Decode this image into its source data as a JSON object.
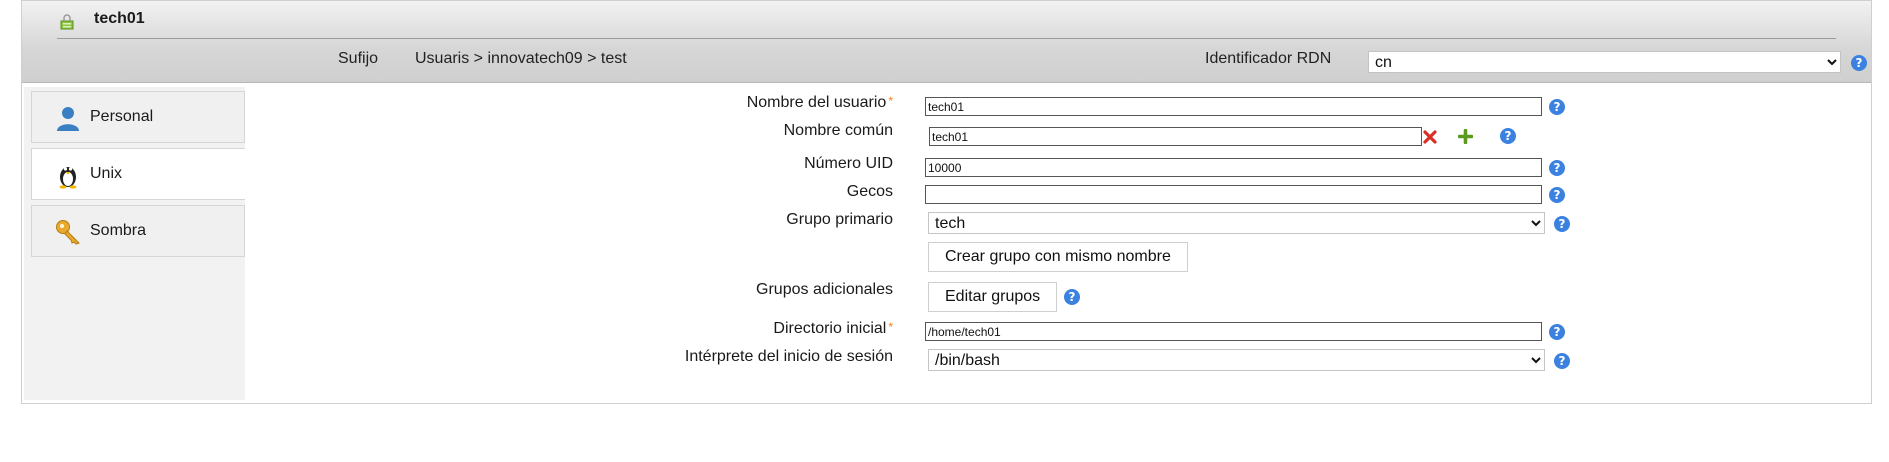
{
  "header": {
    "title": "tech01",
    "suffix_label": "Sufijo",
    "suffix_path": "Usuaris > innovatech09 > test",
    "rdn_label": "Identificador RDN",
    "rdn_value": "cn",
    "help_symbol": "?"
  },
  "tabs": [
    {
      "label": "Personal",
      "icon": "user-icon"
    },
    {
      "label": "Unix",
      "icon": "penguin-icon"
    },
    {
      "label": "Sombra",
      "icon": "key-icon"
    }
  ],
  "active_tab": "Unix",
  "form": {
    "username": {
      "label": "Nombre del usuario",
      "value": "tech01",
      "required_mark": "*"
    },
    "common_name": {
      "label": "Nombre común",
      "value": "tech01"
    },
    "uid": {
      "label": "Número UID",
      "value": "10000"
    },
    "gecos": {
      "label": "Gecos",
      "value": ""
    },
    "primary_group": {
      "label": "Grupo primario",
      "value": "tech"
    },
    "create_group_button": "Crear grupo con mismo nombre",
    "additional_groups": {
      "label": "Grupos adicionales",
      "button": "Editar grupos"
    },
    "home_dir": {
      "label": "Directorio inicial",
      "value": "/home/tech01",
      "required_mark": "*"
    },
    "login_shell": {
      "label": "Intérprete del inicio de sesión",
      "value": "/bin/bash"
    }
  },
  "colors": {
    "help": "#3b82e0",
    "required": "#ff7a1a",
    "remove": "#d93025",
    "add": "#5a9a1e"
  }
}
